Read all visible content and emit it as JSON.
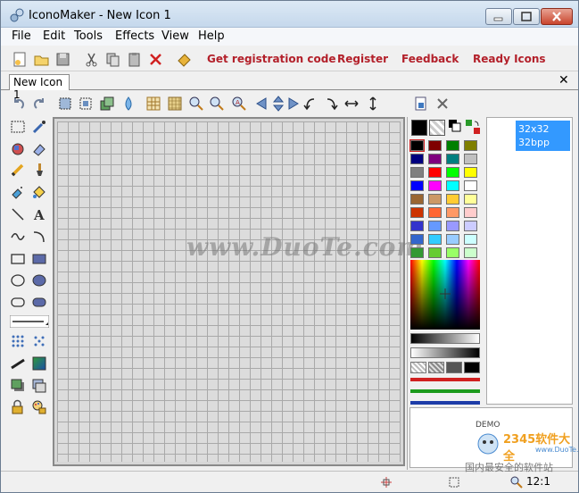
{
  "window": {
    "title": "IconoMaker - New Icon 1"
  },
  "menu": [
    "File",
    "Edit",
    "Tools",
    "Effects",
    "View",
    "Help"
  ],
  "toolbar": {
    "links": [
      "Get registration code",
      "Register",
      "Feedback",
      "Ready Icons"
    ]
  },
  "tabs": {
    "active": "New Icon 1",
    "close": "✕"
  },
  "canvas": {
    "watermark": "www.DuoTe.com"
  },
  "sizes": {
    "item_line1": "32x32",
    "item_line2": "32bpp"
  },
  "demo_panel": {
    "demo_label": "DEMO",
    "brand": "2345软件大全",
    "url": "www.DuoTe.com"
  },
  "status": {
    "zoom": "12:1",
    "bottom_text": "国内最安全的软件站"
  },
  "palette_colors": [
    "#000000",
    "#7f0000",
    "#007f00",
    "#7f7f00",
    "#00007f",
    "#7f007f",
    "#007f7f",
    "#c0c0c0",
    "#808080",
    "#ff0000",
    "#00ff00",
    "#ffff00",
    "#0000ff",
    "#ff00ff",
    "#00ffff",
    "#ffffff",
    "#996633",
    "#cc9966",
    "#ffcc33",
    "#ffff99",
    "#cc3300",
    "#ff6633",
    "#ff9966",
    "#ffcccc",
    "#3333cc",
    "#6699ff",
    "#9999ff",
    "#ccccff",
    "#3366cc",
    "#33ccff",
    "#99ccff",
    "#ccffff",
    "#339933",
    "#66cc33",
    "#99ff66",
    "#ccffcc"
  ]
}
